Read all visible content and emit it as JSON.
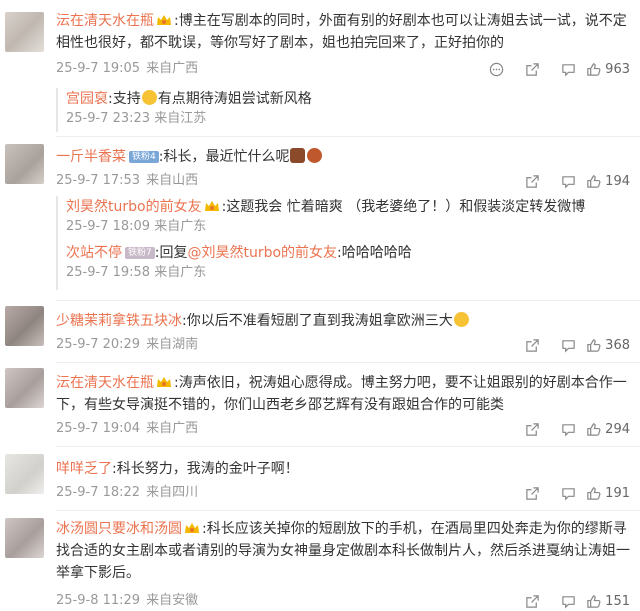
{
  "comments": [
    {
      "nick": "沄在清天水在瓶",
      "text": ":博主在写剧本的同时，外面有别的好剧本也可以让涛姐去试一试，说不定相性也很好，都不耽误，等你写好了剧本，姐也拍完回来了，正好拍你的",
      "time": "25-9-7 19:05",
      "location": "来自广西",
      "likes": "963",
      "reply": {
        "nick": "宫园裒",
        "text": ":支持",
        "text_after": "有点期待涛姐尝试新风格",
        "time": "25-9-7 23:23",
        "location": "来自江苏"
      }
    },
    {
      "nick": "一斤半香菜",
      "level": "铁粉4",
      "text": ":科长，最近忙什么呢",
      "time": "25-9-7 17:53",
      "location": "来自山西",
      "likes": "194",
      "replies": [
        {
          "nick": "刘昊然turbo的前女友",
          "text": ":这题我会 忙着暗爽 （我老婆绝了！）和假装淡定转发微博",
          "time": "25-9-7 18:09",
          "location": "来自广东"
        },
        {
          "nick": "次站不停",
          "level": "铁粉7",
          "text_prefix": ":回复",
          "mention": "@刘昊然turbo的前女友",
          "text": ":哈哈哈哈哈",
          "time": "25-9-7 19:58",
          "location": "来自广东"
        }
      ]
    },
    {
      "nick": "少糖茉莉拿铁五块冰",
      "text": ":你以后不准看短剧了直到我涛姐拿欧洲三大",
      "time": "25-9-7 20:29",
      "location": "来自湖南",
      "likes": "368"
    },
    {
      "nick": "沄在清天水在瓶",
      "text": ":涛声依旧，祝涛姐心愿得成。博主努力吧，要不让姐跟别的好剧本合作一下，有些女导演挺不错的，你们山西老乡邵艺辉有没有跟姐合作的可能类",
      "time": "25-9-7 19:04",
      "location": "来自广西",
      "likes": "294"
    },
    {
      "nick": "咩咩乏了",
      "text": ":科长努力，我涛的金叶子啊！",
      "time": "25-9-7 18:22",
      "location": "来自四川",
      "likes": "191"
    },
    {
      "nick": "冰汤圆只要冰和汤圆",
      "text": ":科长应该关掉你的短剧放下的手机，在酒局里四处奔走为你的缪斯寻找合适的女主剧本或者请别的导演为女神量身定做剧本科长做制片人，然后杀进戛纳让涛姐一举拿下影后。",
      "time": "25-9-8 11:29",
      "location": "来自安徽",
      "likes": "151"
    }
  ],
  "colors": {
    "nick": "#eb7350",
    "meta": "#999999",
    "text": "#333333"
  },
  "icons": [
    "report-icon",
    "share-icon",
    "comment-icon",
    "like-icon",
    "crown-badge-icon"
  ]
}
